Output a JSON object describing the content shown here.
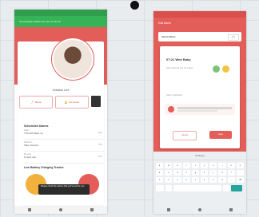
{
  "left": {
    "banner": "Successfully added new user to the list",
    "profile_name": "Jessica Lee",
    "actions": {
      "share": "Share",
      "remind": "Reminder"
    },
    "section_title": "Scheduled Alarms",
    "rows": [
      {
        "k": "Alarm",
        "v": "7:00 AM Wake up",
        "t": "Daily"
      },
      {
        "k": "Medicine",
        "v": "Take vitamins",
        "t": "9:00"
      },
      {
        "k": "Meeting",
        "v": "Project call",
        "t": "3 PM"
      }
    ],
    "progress_title": "Low Battery Charging Tracker",
    "toast": "Please check the alarms that you've set for you"
  },
  "right": {
    "title": "Edit Alarm",
    "field_label": "Alarm Name",
    "field_action": "Edit",
    "dialog_title": "07:21 Wed Baby",
    "dialog_sub": "Alarm that will ring for 2 days",
    "section2": "Alarm Notification",
    "cancel": "Cancel",
    "save": "Save",
    "kb_suggestion": "Notifying",
    "keys": [
      "q",
      "w",
      "e",
      "r",
      "t",
      "y",
      "u",
      "i",
      "o",
      "p",
      "a",
      "s",
      "d",
      "f",
      "g",
      "h",
      "j",
      "k",
      "l",
      "'",
      "⇧",
      "z",
      "x",
      "c",
      "v",
      "b",
      "n",
      "m",
      ",",
      "⌫"
    ]
  },
  "colors": {
    "accent": "#e35d59",
    "green": "#35b356",
    "dark": "#2c2c2c"
  }
}
